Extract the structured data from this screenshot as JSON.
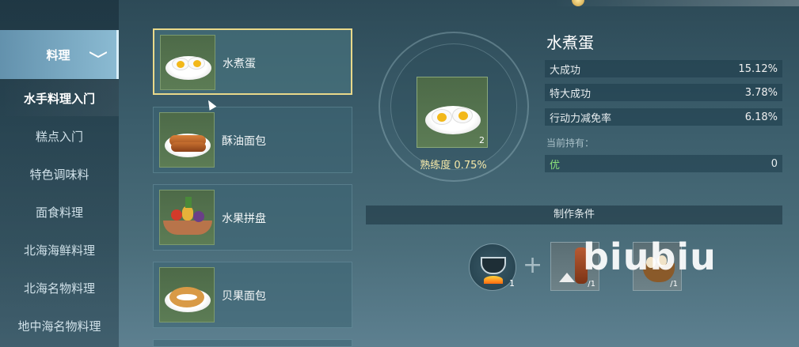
{
  "sidebar": {
    "category": "料理",
    "items": [
      "水手料理入门",
      "糕点入门",
      "特色调味料",
      "面食料理",
      "北海海鲜料理",
      "北海名物料理",
      "地中海名物料理"
    ],
    "active_index": 0
  },
  "recipes": [
    {
      "name": "水煮蛋",
      "icon": "boiled-egg"
    },
    {
      "name": "酥油面包",
      "icon": "butter-bread"
    },
    {
      "name": "水果拼盘",
      "icon": "fruit-platter"
    },
    {
      "name": "贝果面包",
      "icon": "bagel"
    }
  ],
  "detail": {
    "title": "水煮蛋",
    "count": "2",
    "mastery": "熟练度 0.75%",
    "stats": [
      {
        "label": "大成功",
        "value": "15.12%"
      },
      {
        "label": "特大成功",
        "value": "3.78%"
      },
      {
        "label": "行动力减免率",
        "value": "6.18%"
      }
    ],
    "holding_label": "当前持有：",
    "quality": {
      "label": "优",
      "value": "0"
    }
  },
  "craft": {
    "header": "制作条件",
    "pot_count": "1",
    "plus": "+",
    "ingredients": [
      {
        "icon": "salt-and-sausage",
        "count": "/1"
      },
      {
        "icon": "eggs-basket",
        "count": "/1"
      }
    ]
  },
  "watermark": "biubiu",
  "colors": {
    "selected_border": "#e9d98a",
    "quality_green": "#8ae07a",
    "mastery_gold": "#f5e8a8"
  }
}
